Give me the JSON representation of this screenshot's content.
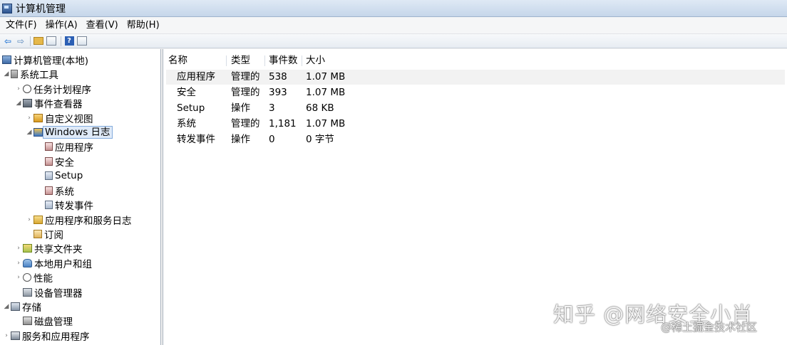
{
  "window": {
    "title": "计算机管理"
  },
  "menubar": {
    "items": [
      {
        "label": "文件(F)"
      },
      {
        "label": "操作(A)"
      },
      {
        "label": "查看(V)"
      },
      {
        "label": "帮助(H)"
      }
    ]
  },
  "toolbar": {
    "buttons": [
      {
        "icon": "back-arrow-icon",
        "glyph": "⇦"
      },
      {
        "icon": "forward-arrow-icon",
        "glyph": "⇨"
      },
      {
        "icon": "up-folder-icon"
      },
      {
        "icon": "show-hide-tree-icon"
      },
      {
        "icon": "help-icon",
        "glyph": "?"
      },
      {
        "icon": "properties-icon"
      }
    ]
  },
  "tree": {
    "items": [
      {
        "label": "计算机管理(本地)",
        "twisty": "",
        "icon": "computer-icon"
      },
      {
        "label": "系统工具",
        "twisty": "◢",
        "icon": "tools-icon"
      },
      {
        "label": "任务计划程序",
        "twisty": "›",
        "icon": "clock-icon"
      },
      {
        "label": "事件查看器",
        "twisty": "◢",
        "icon": "event-viewer-icon"
      },
      {
        "label": "自定义视图",
        "twisty": "›",
        "icon": "filter-icon"
      },
      {
        "label": "Windows 日志",
        "twisty": "◢",
        "icon": "windows-log-icon",
        "selected": true
      },
      {
        "label": "应用程序",
        "twisty": "",
        "icon": "log-icon"
      },
      {
        "label": "安全",
        "twisty": "",
        "icon": "log-icon"
      },
      {
        "label": "Setup",
        "twisty": "",
        "icon": "log-icon"
      },
      {
        "label": "系统",
        "twisty": "",
        "icon": "log-icon"
      },
      {
        "label": "转发事件",
        "twisty": "",
        "icon": "log-icon"
      },
      {
        "label": "应用程序和服务日志",
        "twisty": "›",
        "icon": "folder-icon"
      },
      {
        "label": "订阅",
        "twisty": "",
        "icon": "subscription-icon"
      },
      {
        "label": "共享文件夹",
        "twisty": "›",
        "icon": "shared-folder-icon"
      },
      {
        "label": "本地用户和组",
        "twisty": "›",
        "icon": "users-icon"
      },
      {
        "label": "性能",
        "twisty": "›",
        "icon": "performance-icon"
      },
      {
        "label": "设备管理器",
        "twisty": "",
        "icon": "device-manager-icon"
      },
      {
        "label": "存储",
        "twisty": "◢",
        "icon": "storage-icon"
      },
      {
        "label": "磁盘管理",
        "twisty": "",
        "icon": "disk-icon"
      },
      {
        "label": "服务和应用程序",
        "twisty": "›",
        "icon": "services-icon"
      }
    ]
  },
  "list": {
    "columns": [
      "名称",
      "类型",
      "事件数",
      "大小"
    ],
    "rows": [
      {
        "name": "应用程序",
        "type": "管理的",
        "count": "538",
        "size": "1.07 MB"
      },
      {
        "name": "安全",
        "type": "管理的",
        "count": "393",
        "size": "1.07 MB"
      },
      {
        "name": "Setup",
        "type": "操作",
        "count": "3",
        "size": "68 KB"
      },
      {
        "name": "系统",
        "type": "管理的",
        "count": "1,181",
        "size": "1.07 MB"
      },
      {
        "name": "转发事件",
        "type": "操作",
        "count": "0",
        "size": "0 字节"
      }
    ]
  },
  "watermark": {
    "line1": "知乎 @网络安全小肖",
    "line2": "@稀土掘金技术社区"
  }
}
